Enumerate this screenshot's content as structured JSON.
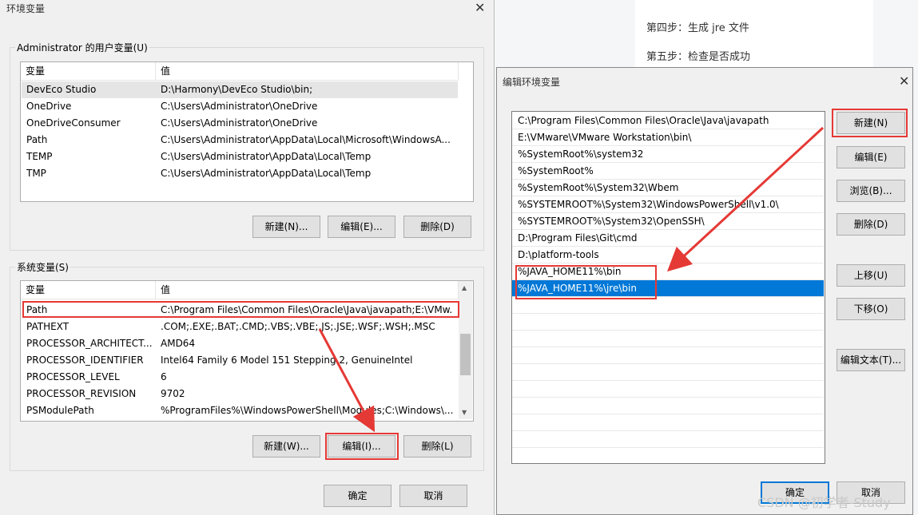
{
  "env_dialog": {
    "title": "环境变量",
    "close": "✕",
    "user_group_label": "Administrator 的用户变量(U)",
    "user_headers": [
      "变量",
      "值"
    ],
    "user_vars": [
      {
        "name": "DevEco Studio",
        "value": "D:\\Harmony\\DevEco Studio\\bin;"
      },
      {
        "name": "OneDrive",
        "value": "C:\\Users\\Administrator\\OneDrive"
      },
      {
        "name": "OneDriveConsumer",
        "value": "C:\\Users\\Administrator\\OneDrive"
      },
      {
        "name": "Path",
        "value": "C:\\Users\\Administrator\\AppData\\Local\\Microsoft\\WindowsA..."
      },
      {
        "name": "TEMP",
        "value": "C:\\Users\\Administrator\\AppData\\Local\\Temp"
      },
      {
        "name": "TMP",
        "value": "C:\\Users\\Administrator\\AppData\\Local\\Temp"
      }
    ],
    "user_buttons": {
      "new": "新建(N)...",
      "edit": "编辑(E)...",
      "delete": "删除(D)"
    },
    "system_group_label": "系统变量(S)",
    "system_headers": [
      "变量",
      "值"
    ],
    "system_vars": [
      {
        "name": "Path",
        "value": "C:\\Program Files\\Common Files\\Oracle\\Java\\javapath;E:\\VMw..."
      },
      {
        "name": "PATHEXT",
        "value": ".COM;.EXE;.BAT;.CMD;.VBS;.VBE;.JS;.JSE;.WSF;.WSH;.MSC"
      },
      {
        "name": "PROCESSOR_ARCHITECT...",
        "value": "AMD64"
      },
      {
        "name": "PROCESSOR_IDENTIFIER",
        "value": "Intel64 Family 6 Model 151 Stepping 2, GenuineIntel"
      },
      {
        "name": "PROCESSOR_LEVEL",
        "value": "6"
      },
      {
        "name": "PROCESSOR_REVISION",
        "value": "9702"
      },
      {
        "name": "PSModulePath",
        "value": "%ProgramFiles%\\WindowsPowerShell\\Modules;C:\\Windows\\..."
      }
    ],
    "system_buttons": {
      "new": "新建(W)...",
      "edit": "编辑(I)...",
      "delete": "删除(L)"
    },
    "ok": "确定",
    "cancel": "取消"
  },
  "doc": {
    "steps": [
      "第四步：生成 jre 文件",
      "第五步：检查是否成功"
    ]
  },
  "edit_dialog": {
    "title": "编辑环境变量",
    "close": "✕",
    "paths": [
      "C:\\Program Files\\Common Files\\Oracle\\Java\\javapath",
      "E:\\VMware\\VMware Workstation\\bin\\",
      "%SystemRoot%\\system32",
      "%SystemRoot%",
      "%SystemRoot%\\System32\\Wbem",
      "%SYSTEMROOT%\\System32\\WindowsPowerShell\\v1.0\\",
      "%SYSTEMROOT%\\System32\\OpenSSH\\",
      "D:\\Program Files\\Git\\cmd",
      "D:\\platform-tools",
      "%JAVA_HOME11%\\bin",
      "%JAVA_HOME11%\\jre\\bin"
    ],
    "selected_index": 10,
    "buttons": {
      "new": "新建(N)",
      "edit": "编辑(E)",
      "browse": "浏览(B)...",
      "delete": "删除(D)",
      "move_up": "上移(U)",
      "move_down": "下移(O)",
      "edit_text": "编辑文本(T)..."
    },
    "ok": "确定",
    "cancel": "取消"
  },
  "watermark": "CSDN @初学者-Study",
  "colors": {
    "highlight_box": "#e53935",
    "selection": "#0078d7",
    "arrow": "#e53935"
  }
}
